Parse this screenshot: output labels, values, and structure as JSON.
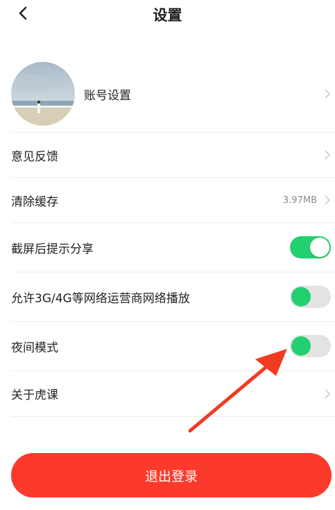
{
  "header": {
    "title": "设置",
    "back_icon": "chevron-left-icon"
  },
  "settings": {
    "account": {
      "label": "账号设置"
    },
    "feedback": {
      "label": "意见反馈"
    },
    "cache": {
      "label": "清除缓存",
      "size": "3.97MB"
    },
    "screenshot_share": {
      "label": "截屏后提示分享",
      "enabled": true
    },
    "mobile_network": {
      "label": "允许3G/4G等网络运营商网络播放",
      "enabled": false
    },
    "night_mode": {
      "label": "夜间模式",
      "enabled": false
    },
    "about": {
      "label": "关于虎课"
    }
  },
  "logout": {
    "label": "退出登录"
  },
  "colors": {
    "accent_green": "#23d06f",
    "logout_red": "#fc3a2b",
    "annotation_arrow": "#f23a22"
  }
}
